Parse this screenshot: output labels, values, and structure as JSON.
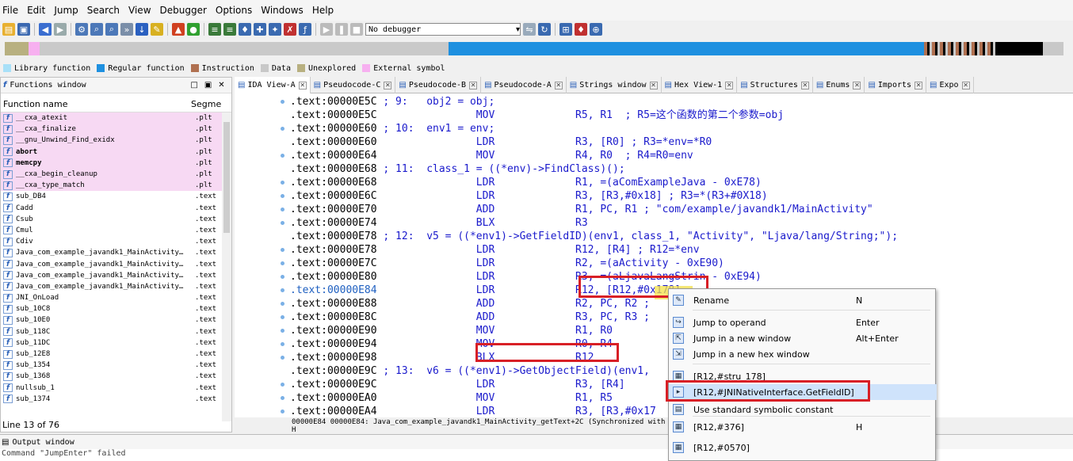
{
  "menubar": [
    "File",
    "Edit",
    "Jump",
    "Search",
    "View",
    "Debugger",
    "Options",
    "Windows",
    "Help"
  ],
  "toolbar": {
    "debugger_select": "No debugger"
  },
  "legend": [
    {
      "label": "Library function",
      "color": "#a8e0f8"
    },
    {
      "label": "Regular function",
      "color": "#1e90e0"
    },
    {
      "label": "Instruction",
      "color": "#b07050"
    },
    {
      "label": "Data",
      "color": "#c8c8c8"
    },
    {
      "label": "Unexplored",
      "color": "#b8b080"
    },
    {
      "label": "External symbol",
      "color": "#f7b0f0"
    }
  ],
  "functions_window": {
    "title": "Functions window",
    "col_name": "Function name",
    "col_segment": "Segme",
    "rows": [
      {
        "name": "__cxa_atexit",
        "seg": ".plt",
        "pink": true,
        "bold": false
      },
      {
        "name": "__cxa_finalize",
        "seg": ".plt",
        "pink": true,
        "bold": false
      },
      {
        "name": "__gnu_Unwind_Find_exidx",
        "seg": ".plt",
        "pink": true,
        "bold": false
      },
      {
        "name": "abort",
        "seg": ".plt",
        "pink": true,
        "bold": true
      },
      {
        "name": "memcpy",
        "seg": ".plt",
        "pink": true,
        "bold": true
      },
      {
        "name": "__cxa_begin_cleanup",
        "seg": ".plt",
        "pink": true,
        "bold": false
      },
      {
        "name": "__cxa_type_match",
        "seg": ".plt",
        "pink": true,
        "bold": false
      },
      {
        "name": "sub_DB4",
        "seg": ".text",
        "pink": false,
        "bold": false
      },
      {
        "name": "Cadd",
        "seg": ".text",
        "pink": false,
        "bold": false
      },
      {
        "name": "Csub",
        "seg": ".text",
        "pink": false,
        "bold": false
      },
      {
        "name": "Cmul",
        "seg": ".text",
        "pink": false,
        "bold": false
      },
      {
        "name": "Cdiv",
        "seg": ".text",
        "pink": false,
        "bold": false
      },
      {
        "name": "Java_com_example_javandk1_MainActivity…",
        "seg": ".text",
        "pink": false,
        "bold": false
      },
      {
        "name": "Java_com_example_javandk1_MainActivity…",
        "seg": ".text",
        "pink": false,
        "bold": false
      },
      {
        "name": "Java_com_example_javandk1_MainActivity…",
        "seg": ".text",
        "pink": false,
        "bold": false
      },
      {
        "name": "Java_com_example_javandk1_MainActivity…",
        "seg": ".text",
        "pink": false,
        "bold": false
      },
      {
        "name": "JNI_OnLoad",
        "seg": ".text",
        "pink": false,
        "bold": false
      },
      {
        "name": "sub_10C8",
        "seg": ".text",
        "pink": false,
        "bold": false
      },
      {
        "name": "sub_10E0",
        "seg": ".text",
        "pink": false,
        "bold": false
      },
      {
        "name": "sub_118C",
        "seg": ".text",
        "pink": false,
        "bold": false
      },
      {
        "name": "sub_11DC",
        "seg": ".text",
        "pink": false,
        "bold": false
      },
      {
        "name": "sub_12E8",
        "seg": ".text",
        "pink": false,
        "bold": false
      },
      {
        "name": "sub_1354",
        "seg": ".text",
        "pink": false,
        "bold": false
      },
      {
        "name": "sub_1368",
        "seg": ".text",
        "pink": false,
        "bold": false
      },
      {
        "name": "nullsub_1",
        "seg": ".text",
        "pink": false,
        "bold": false
      },
      {
        "name": "sub_1374",
        "seg": ".text",
        "pink": false,
        "bold": false
      }
    ],
    "status": "Line 13 of 76"
  },
  "tabs": [
    {
      "label": "IDA View-A",
      "active": true
    },
    {
      "label": "Pseudocode-C",
      "active": false
    },
    {
      "label": "Pseudocode-B",
      "active": false
    },
    {
      "label": "Pseudocode-A",
      "active": false
    },
    {
      "label": "Strings window",
      "active": false
    },
    {
      "label": "Hex View-1",
      "active": false
    },
    {
      "label": "Structures",
      "active": false
    },
    {
      "label": "Enums",
      "active": false
    },
    {
      "label": "Imports",
      "active": false
    },
    {
      "label": "Expo",
      "active": false
    }
  ],
  "code_lines": [
    {
      "addr": ".text:00000E5C",
      "rest": " ; 9:   obj2 = obj;",
      "kind": "comment",
      "dot": true
    },
    {
      "addr": ".text:00000E5C",
      "rest": "                MOV             R5, R1  ; R5=这个函数的第二个参数=obj",
      "kind": "insn",
      "dot": false
    },
    {
      "addr": ".text:00000E60",
      "rest": " ; 10:  env1 = env;",
      "kind": "comment",
      "dot": true
    },
    {
      "addr": ".text:00000E60",
      "rest": "                LDR             R3, [R0] ; R3=*env=*R0",
      "kind": "insn",
      "dot": false
    },
    {
      "addr": ".text:00000E64",
      "rest": "                MOV             R4, R0  ; R4=R0=env",
      "kind": "insn",
      "dot": true
    },
    {
      "addr": ".text:00000E68",
      "rest": " ; 11:  class_1 = ((*env)->FindClass)();",
      "kind": "comment",
      "dot": false
    },
    {
      "addr": ".text:00000E68",
      "rest": "                LDR             R1, =(aComExampleJava - 0xE78)",
      "kind": "insn",
      "dot": true
    },
    {
      "addr": ".text:00000E6C",
      "rest": "                LDR             R3, [R3,#0x18] ; R3=*(R3+#0X18)",
      "kind": "insn",
      "dot": true
    },
    {
      "addr": ".text:00000E70",
      "rest": "                ADD             R1, PC, R1 ; \"com/example/javandk1/MainActivity\"",
      "kind": "insn",
      "dot": true
    },
    {
      "addr": ".text:00000E74",
      "rest": "                BLX             R3",
      "kind": "insn",
      "dot": true
    },
    {
      "addr": ".text:00000E78",
      "rest": " ; 12:  v5 = ((*env1)->GetFieldID)(env1, class_1, \"Activity\", \"Ljava/lang/String;\");",
      "kind": "comment",
      "dot": false
    },
    {
      "addr": ".text:00000E78",
      "rest": "                LDR             R12, [R4] ; R12=*env",
      "kind": "insn",
      "dot": true
    },
    {
      "addr": ".text:00000E7C",
      "rest": "                LDR             R2, =(aActivity - 0xE90)",
      "kind": "insn",
      "dot": true
    },
    {
      "addr": ".text:00000E80",
      "rest": "                LDR             R3, =(aLjavaLangStrin - 0xE94)",
      "kind": "insn",
      "dot": true
    },
    {
      "addr": ".text:00000E84",
      "rest": "                LDR             R12, [R12,#0x178]",
      "kind": "insn",
      "dot": true
    },
    {
      "addr": ".text:00000E88",
      "rest": "                ADD             R2, PC, R2 ;",
      "kind": "insn",
      "dot": true
    },
    {
      "addr": ".text:00000E8C",
      "rest": "                ADD             R3, PC, R3 ;",
      "kind": "insn",
      "dot": true
    },
    {
      "addr": ".text:00000E90",
      "rest": "                MOV             R1, R0",
      "kind": "insn",
      "dot": true
    },
    {
      "addr": ".text:00000E94",
      "rest": "                MOV             R0, R4",
      "kind": "insn",
      "dot": true
    },
    {
      "addr": ".text:00000E98",
      "rest": "                BLX             R12",
      "kind": "insn",
      "dot": true
    },
    {
      "addr": ".text:00000E9C",
      "rest": " ; 13:  v6 = ((*env1)->GetObjectField)(env1,",
      "kind": "comment",
      "dot": false
    },
    {
      "addr": ".text:00000E9C",
      "rest": "                LDR             R3, [R4]",
      "kind": "insn",
      "dot": true
    },
    {
      "addr": ".text:00000EA0",
      "rest": "                MOV             R1, R5",
      "kind": "insn",
      "dot": true
    },
    {
      "addr": ".text:00000EA4",
      "rest": "                LDR             R3, [R3,#0x17",
      "kind": "insn",
      "dot": true
    }
  ],
  "code_status": "00000E84 00000E84: Java_com_example_javandk1_MainActivity_getText+2C (Synchronized with H",
  "output_window": {
    "title": "Output window",
    "text": "Command \"JumpEnter\" failed"
  },
  "context_menu": [
    {
      "label": "Rename",
      "key": "N"
    },
    {
      "label": "Jump to operand",
      "key": "Enter"
    },
    {
      "label": "Jump in a new window",
      "key": "Alt+Enter"
    },
    {
      "label": "Jump in a new hex window",
      "key": ""
    },
    {
      "label": "[R12,#stru_178]",
      "key": ""
    },
    {
      "label": "[R12,#JNINativeInterface.GetFieldID]",
      "key": ""
    },
    {
      "label": "Use standard symbolic constant",
      "key": ""
    },
    {
      "label": "[R12,#376]",
      "key": "H"
    },
    {
      "label": "[R12,#0570]",
      "key": ""
    }
  ],
  "colors": {
    "highlight_blue": "#1e5fc0",
    "menu_highlight": "#cfe3fb",
    "red_box": "#d81f26",
    "nav_blue": "#1e90e0"
  }
}
